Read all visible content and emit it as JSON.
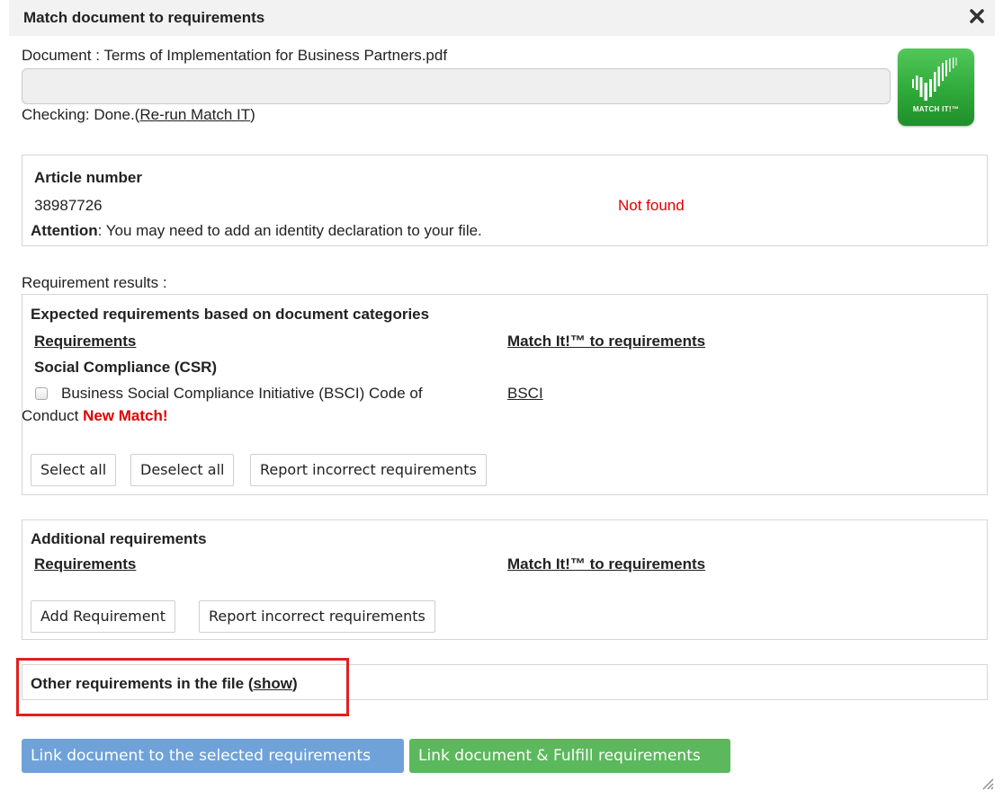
{
  "dialog": {
    "title": "Match document to requirements"
  },
  "document": {
    "label": "Document : Terms of Implementation for Business Partners.pdf",
    "checking_prefix": "Checking: Done.(",
    "rerun_link": "Re-run Match IT",
    "checking_suffix": ")"
  },
  "logo": {
    "text": "MATCH IT!™"
  },
  "article": {
    "heading": "Article number",
    "number": "38987726",
    "status": "Not found",
    "attention_label": "Attention",
    "attention_text": ": You may need to add an identity declaration to your file."
  },
  "results_label": "Requirement results :",
  "expected": {
    "heading": "Expected requirements based on document categories",
    "col_requirements": "Requirements",
    "col_match": "Match It!™ to requirements",
    "category": "Social Compliance (CSR)",
    "item_line1": "Business Social Compliance Initiative (BSCI) Code of",
    "item_line2": "Conduct",
    "new_match": "New Match!",
    "match_link": "BSCI",
    "btn_select_all": "Select all",
    "btn_deselect_all": "Deselect all",
    "btn_report": "Report incorrect requirements"
  },
  "additional": {
    "heading": "Additional requirements",
    "col_requirements": "Requirements",
    "col_match": "Match It!™ to requirements",
    "btn_add": "Add Requirement",
    "btn_report": "Report incorrect requirements"
  },
  "other": {
    "text": "Other requirements in the file (",
    "show_link": "show",
    "close_paren": ")"
  },
  "actions": {
    "link_selected": "Link document to the selected requirements",
    "link_fulfill": "Link document & Fulfill requirements"
  },
  "colors": {
    "accent_blue": "#6fa2d8",
    "accent_green": "#5cb85c",
    "alert_red": "#e00000",
    "highlight_red": "#e02020"
  }
}
